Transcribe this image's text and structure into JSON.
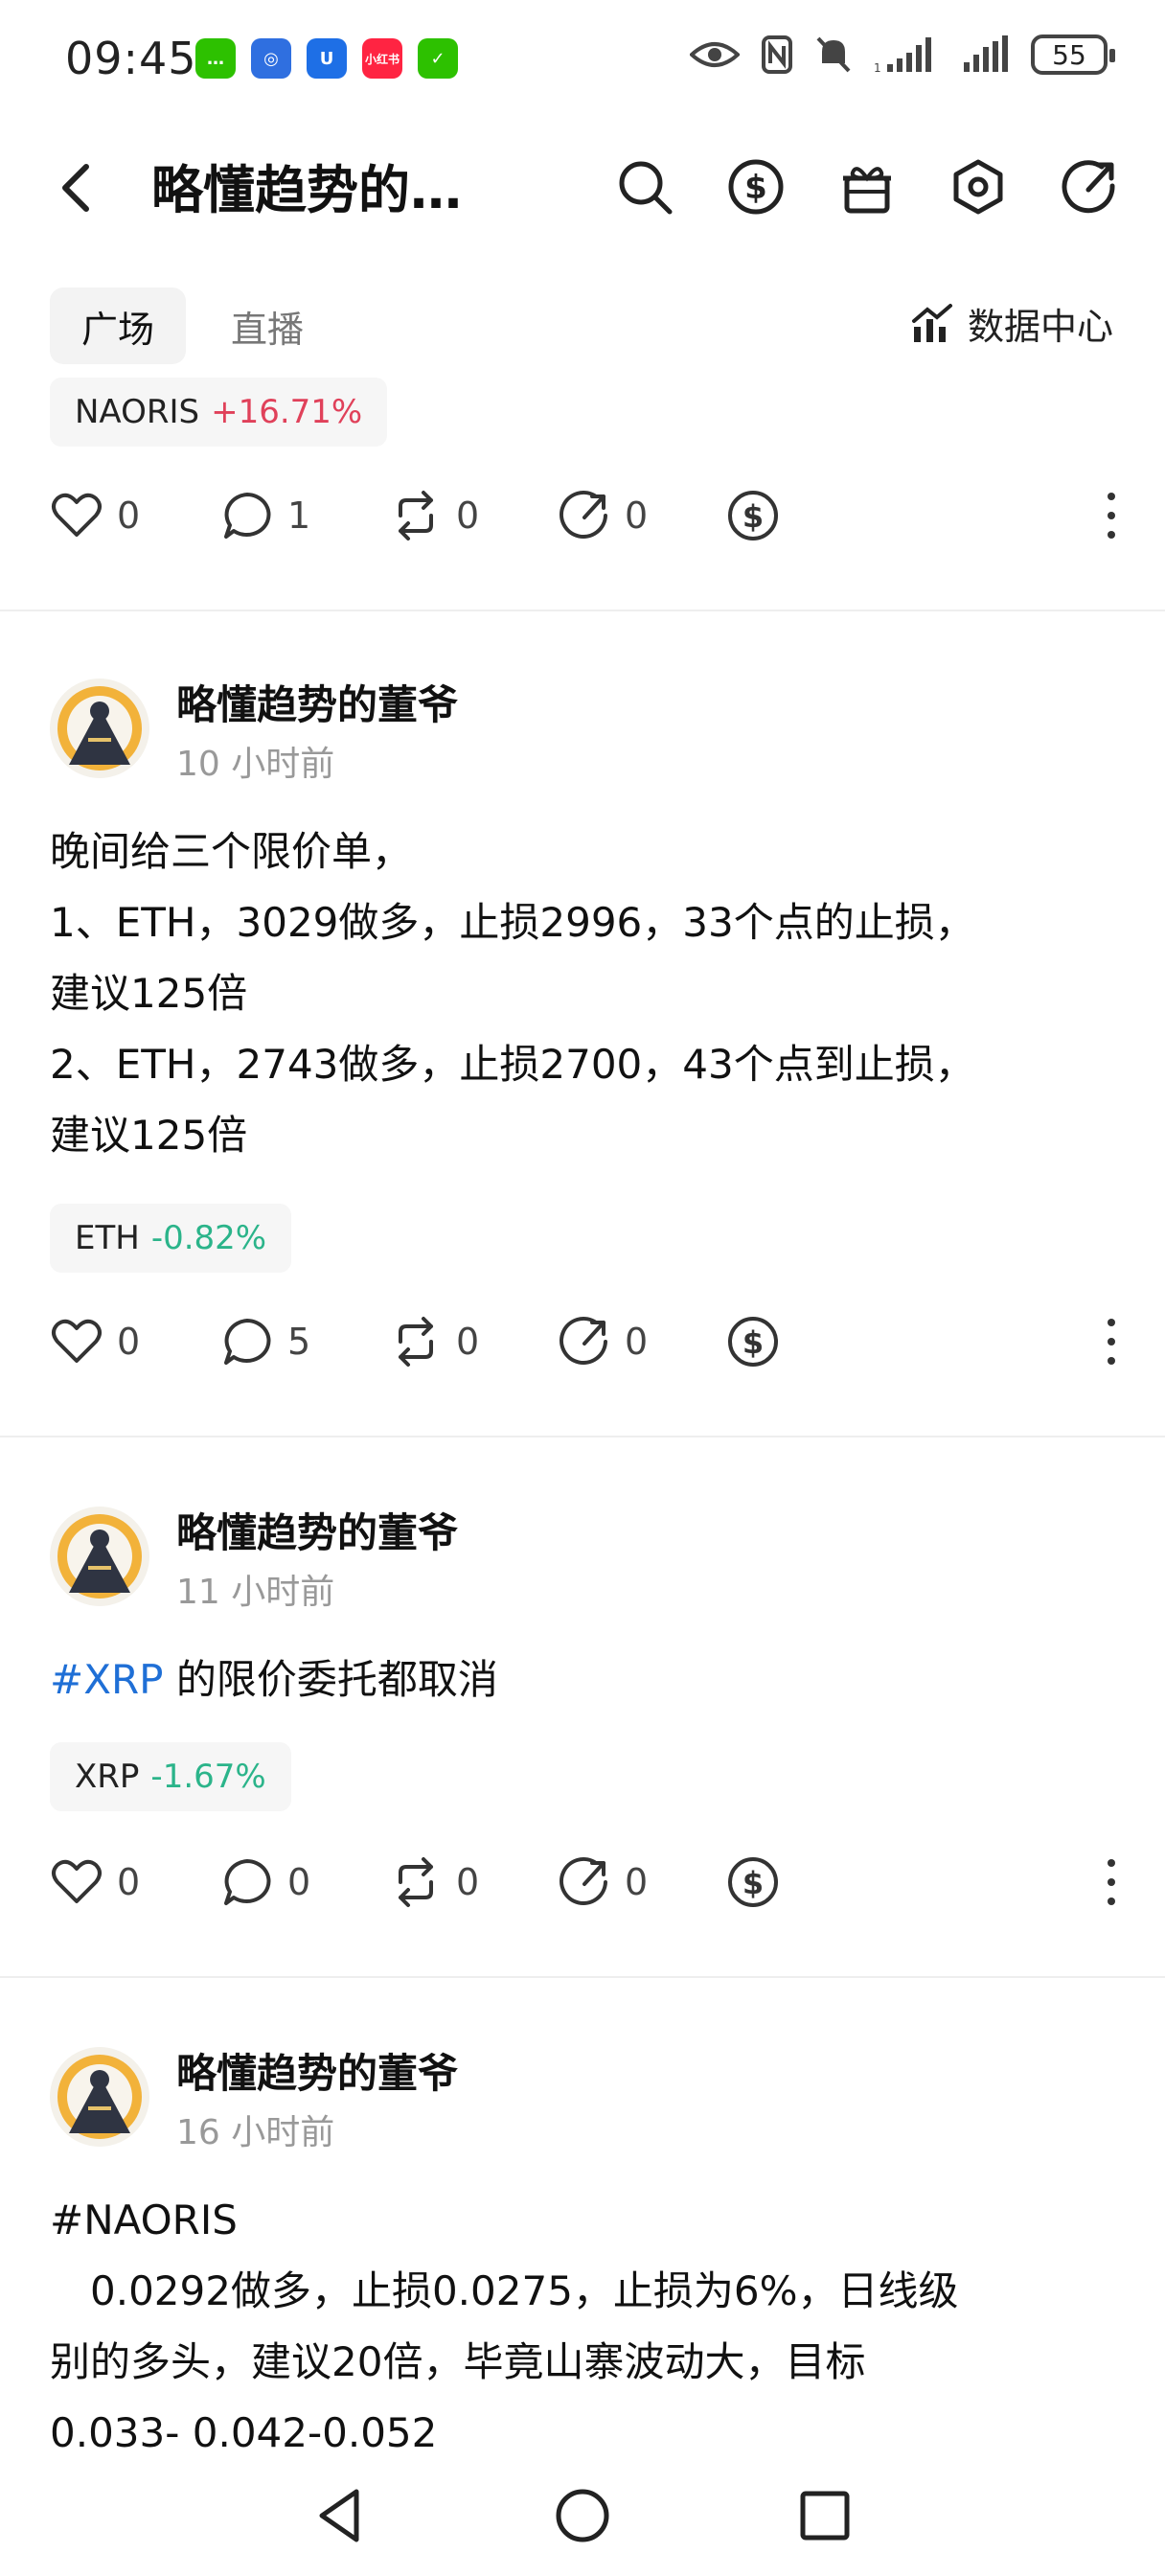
{
  "status_bar": {
    "time": "09:45",
    "apps": [
      {
        "name": "wechat-icon",
        "color": "#2dc100",
        "glyph": "…"
      },
      {
        "name": "browser-icon",
        "color": "#2f6fe0",
        "glyph": "◎"
      },
      {
        "name": "u-app-icon",
        "color": "#1e6fe6",
        "glyph": "U"
      },
      {
        "name": "xiaohongshu-icon",
        "color": "#ff2442",
        "glyph": "小红书"
      },
      {
        "name": "wechat-pay-icon",
        "color": "#2dc100",
        "glyph": "✓"
      }
    ],
    "battery": "55"
  },
  "header": {
    "title": "略懂趋势的…"
  },
  "tabs": [
    {
      "label": "广场",
      "active": true
    },
    {
      "label": "直播",
      "active": false
    }
  ],
  "data_center_label": "数据中心",
  "top_post": {
    "coin": {
      "symbol": "NAORIS",
      "change": "+16.71%"
    },
    "likes": "0",
    "comments": "1",
    "reposts": "0",
    "shares": "0"
  },
  "posts": [
    {
      "author": "略懂趋势的董爷",
      "time": "10 小时前",
      "lines": [
        "晚间给三个限价单，",
        "1、ETH，3029做多，止损2996，33个点的止损，",
        "建议125倍",
        "2、ETH，2743做多，止损2700，43个点到止损，",
        "建议125倍"
      ],
      "coin": {
        "symbol": "ETH",
        "change": "-0.82%"
      },
      "likes": "0",
      "comments": "5",
      "reposts": "0",
      "shares": "0"
    },
    {
      "author": "略懂趋势的董爷",
      "time": "11 小时前",
      "hashtag": "#XRP",
      "text": " 的限价委托都取消",
      "coin": {
        "symbol": "XRP",
        "change": "-1.67%"
      },
      "likes": "0",
      "comments": "0",
      "reposts": "0",
      "shares": "0"
    },
    {
      "author": "略懂趋势的董爷",
      "time": "16 小时前",
      "lines": [
        "#NAORIS",
        "　0.0292做多，止损0.0275，止损为6%，日线级",
        "别的多头，建议20倍，毕竟山寨波动大，目标",
        "0.033- 0.042-0.052"
      ]
    }
  ]
}
